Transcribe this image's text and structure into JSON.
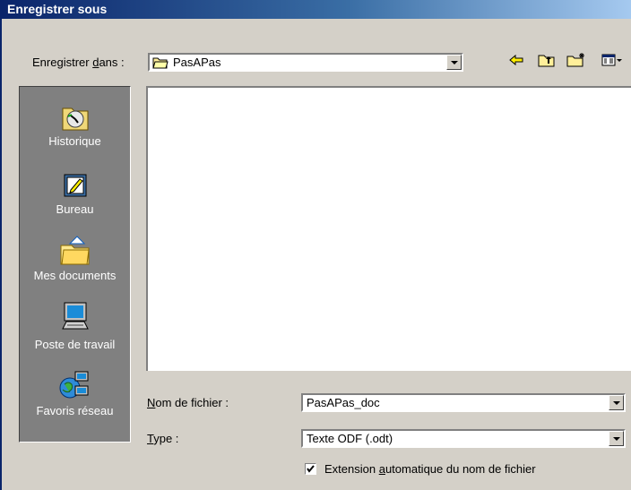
{
  "dialog": {
    "title": "Enregistrer sous"
  },
  "save_in": {
    "label_pre": "Enregistrer ",
    "label_access": "d",
    "label_post": "ans :",
    "folder": "PasAPas"
  },
  "places": [
    {
      "label": "Historique",
      "icon": "history-icon"
    },
    {
      "label": "Bureau",
      "icon": "desktop-icon"
    },
    {
      "label": "Mes documents",
      "icon": "my-documents-icon"
    },
    {
      "label": "Poste de travail",
      "icon": "my-computer-icon"
    },
    {
      "label": "Favoris réseau",
      "icon": "network-places-icon"
    }
  ],
  "filename": {
    "label_access": "N",
    "label_rest": "om de fichier :",
    "value": "PasAPas_doc"
  },
  "filetype": {
    "label_access": "T",
    "label_rest": "ype :",
    "value": "Texte ODF (.odt)"
  },
  "auto_extension": {
    "checked": true,
    "label_pre": "Extension ",
    "label_access": "a",
    "label_post": "utomatique du nom de fichier"
  },
  "toolbar_icons": [
    "back-arrow-icon",
    "up-folder-icon",
    "new-folder-icon",
    "view-menu-icon"
  ]
}
